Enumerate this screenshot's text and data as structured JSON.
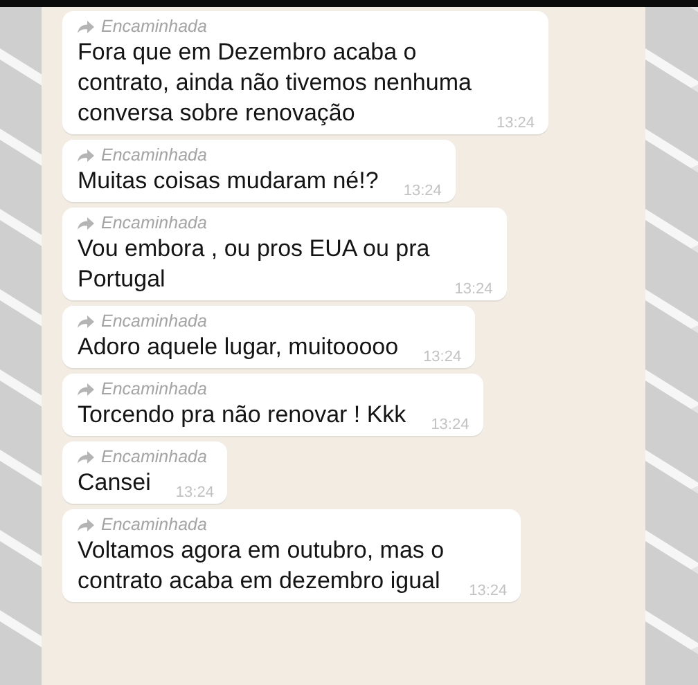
{
  "messages": [
    {
      "forwarded_label": "Encaminhada",
      "text": "Fora que em Dezembro acaba o\ncontrato, ainda não tivemos nenhuma\nconversa sobre renovação",
      "time": "13:24"
    },
    {
      "forwarded_label": "Encaminhada",
      "text": "Muitas coisas mudaram né!?",
      "time": "13:24"
    },
    {
      "forwarded_label": "Encaminhada",
      "text": "Vou embora , ou pros EUA ou pra\nPortugal",
      "time": "13:24"
    },
    {
      "forwarded_label": "Encaminhada",
      "text": "Adoro aquele lugar, muitooooo",
      "time": "13:24"
    },
    {
      "forwarded_label": "Encaminhada",
      "text": "Torcendo pra não renovar ! Kkk",
      "time": "13:24"
    },
    {
      "forwarded_label": "Encaminhada",
      "text": "Cansei",
      "time": "13:24"
    },
    {
      "forwarded_label": "Encaminhada",
      "text": "Voltamos agora em outubro, mas o\ncontrato acaba em dezembro igual",
      "time": "13:24"
    }
  ]
}
